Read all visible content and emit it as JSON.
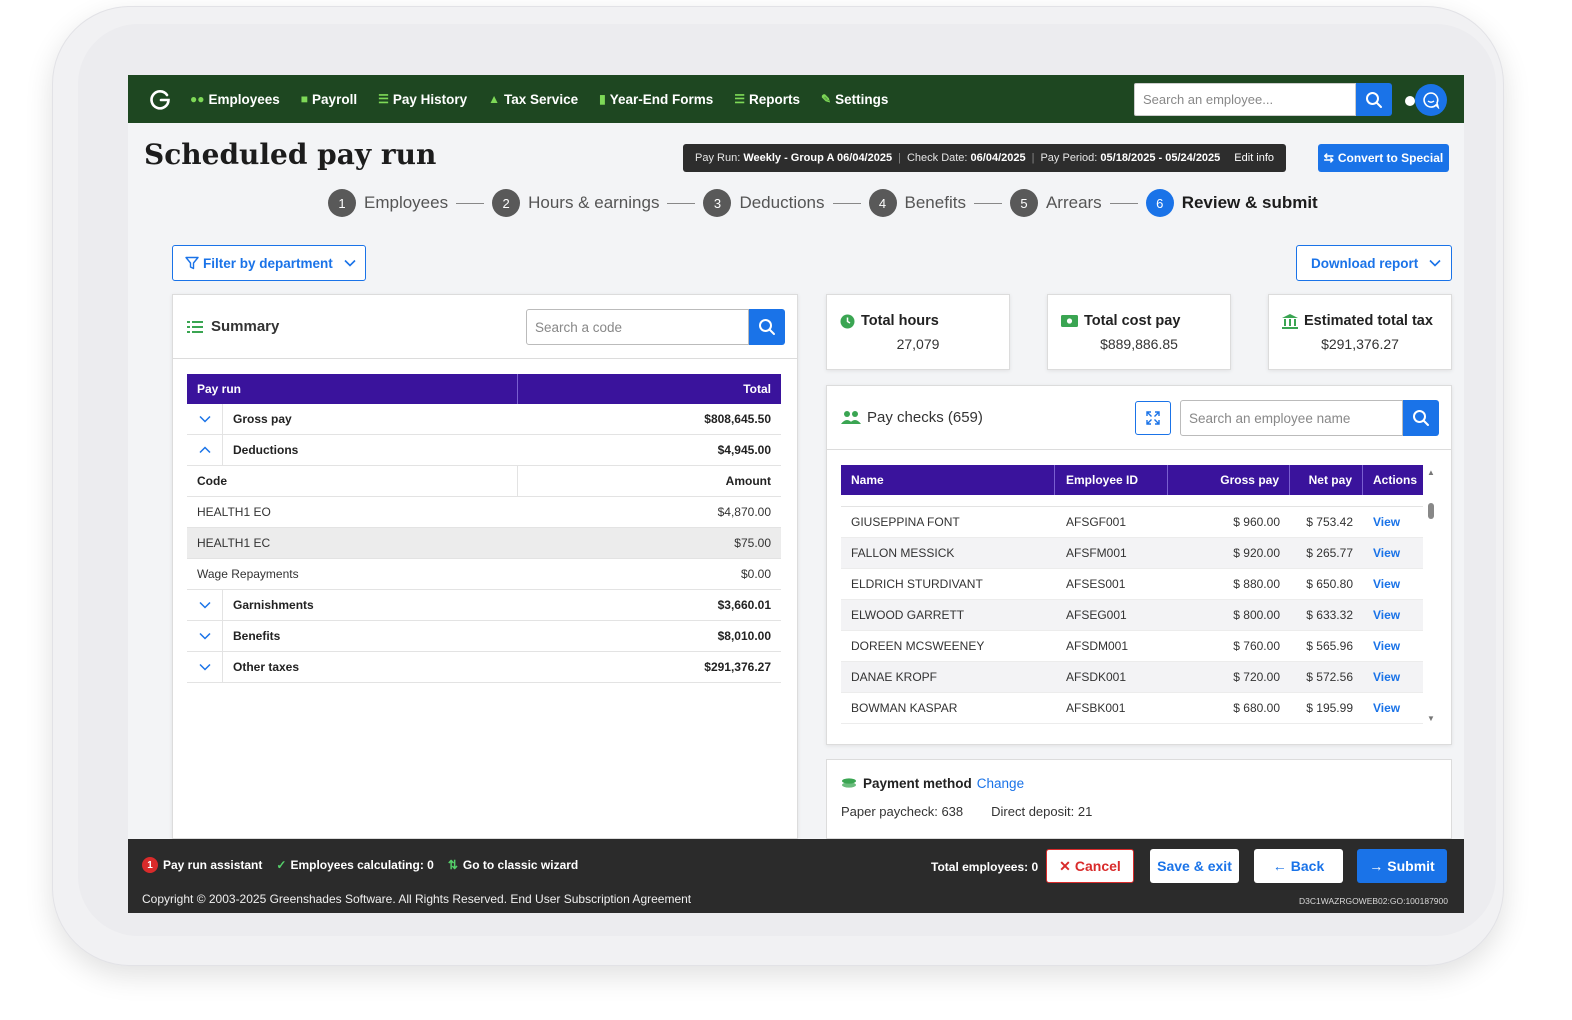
{
  "nav": {
    "items": [
      {
        "label": "Employees",
        "icon": "people-icon"
      },
      {
        "label": "Payroll",
        "icon": "money-icon"
      },
      {
        "label": "Pay History",
        "icon": "list-icon"
      },
      {
        "label": "Tax Service",
        "icon": "bank-icon"
      },
      {
        "label": "Year-End Forms",
        "icon": "document-icon"
      },
      {
        "label": "Reports",
        "icon": "list-icon"
      },
      {
        "label": "Settings",
        "icon": "wrench-icon"
      }
    ],
    "search_placeholder": "Search an employee..."
  },
  "header": {
    "title": "Scheduled pay run",
    "pay_run_label": "Pay Run:",
    "pay_run_value": "Weekly - Group A 06/04/2025",
    "check_date_label": "Check Date:",
    "check_date_value": "06/04/2025",
    "pay_period_label": "Pay Period:",
    "pay_period_value": "05/18/2025 - 05/24/2025",
    "edit_info": "Edit info",
    "convert_label": "Convert to Special"
  },
  "steps": [
    {
      "num": "1",
      "label": "Employees",
      "active": false
    },
    {
      "num": "2",
      "label": "Hours & earnings",
      "active": false
    },
    {
      "num": "3",
      "label": "Deductions",
      "active": false
    },
    {
      "num": "4",
      "label": "Benefits",
      "active": false
    },
    {
      "num": "5",
      "label": "Arrears",
      "active": false
    },
    {
      "num": "6",
      "label": "Review & submit",
      "active": true
    }
  ],
  "filter_label": "Filter by department",
  "download_label": "Download report",
  "summary": {
    "title": "Summary",
    "search_placeholder": "Search a code",
    "col_pay_run": "Pay run",
    "col_total": "Total",
    "gross_pay": {
      "label": "Gross pay",
      "value": "$808,645.50"
    },
    "deductions": {
      "label": "Deductions",
      "value": "$4,945.00"
    },
    "code_col": "Code",
    "amount_col": "Amount",
    "deduction_rows": [
      {
        "code": "HEALTH1 EO",
        "amount": "$4,870.00"
      },
      {
        "code": "HEALTH1 EC",
        "amount": "$75.00"
      },
      {
        "code": "Wage Repayments",
        "amount": "$0.00"
      }
    ],
    "garnishments": {
      "label": "Garnishments",
      "value": "$3,660.01"
    },
    "benefits": {
      "label": "Benefits",
      "value": "$8,010.00"
    },
    "other_taxes": {
      "label": "Other taxes",
      "value": "$291,376.27"
    }
  },
  "stats": {
    "total_hours": {
      "label": "Total hours",
      "value": "27,079"
    },
    "total_cost": {
      "label": "Total cost pay",
      "value": "$889,886.85"
    },
    "est_tax": {
      "label": "Estimated total tax",
      "value": "$291,376.27"
    }
  },
  "paychecks": {
    "title": "Pay checks (659)",
    "search_placeholder": "Search an employee name",
    "columns": {
      "name": "Name",
      "id": "Employee ID",
      "gross": "Gross pay",
      "net": "Net pay",
      "actions": "Actions"
    },
    "rows": [
      {
        "name": "GIUSEPPINA FONT",
        "id": "AFSGF001",
        "gross": "$ 960.00",
        "net": "$ 753.42",
        "action": "View"
      },
      {
        "name": "FALLON MESSICK",
        "id": "AFSFM001",
        "gross": "$ 920.00",
        "net": "$ 265.77",
        "action": "View"
      },
      {
        "name": "ELDRICH STURDIVANT",
        "id": "AFSES001",
        "gross": "$ 880.00",
        "net": "$ 650.80",
        "action": "View"
      },
      {
        "name": "ELWOOD GARRETT",
        "id": "AFSEG001",
        "gross": "$ 800.00",
        "net": "$ 633.32",
        "action": "View"
      },
      {
        "name": "DOREEN MCSWEENEY",
        "id": "AFSDM001",
        "gross": "$ 760.00",
        "net": "$ 565.96",
        "action": "View"
      },
      {
        "name": "DANAE KROPF",
        "id": "AFSDK001",
        "gross": "$ 720.00",
        "net": "$ 572.56",
        "action": "View"
      },
      {
        "name": "BOWMAN KASPAR",
        "id": "AFSBK001",
        "gross": "$ 680.00",
        "net": "$ 195.99",
        "action": "View"
      }
    ]
  },
  "payment": {
    "title": "Payment method",
    "change": "Change",
    "paper": "Paper paycheck: 638",
    "direct": "Direct deposit: 21"
  },
  "footer": {
    "assistant_badge": "1",
    "assistant": "Pay run assistant",
    "calculating": "Employees calculating: 0",
    "classic": "Go to classic wizard",
    "total_employees": "Total employees: 0",
    "cancel": "Cancel",
    "save_exit": "Save & exit",
    "back": "Back",
    "submit": "Submit",
    "copyright": "Copyright © 2003-2025 Greenshades Software. All Rights Reserved. End User Subscription Agreement",
    "build": "D3C1WAZRGOWEB02:GO:100187900"
  },
  "colors": {
    "nav_bg": "#1e4721",
    "accent": "#1a73e8",
    "table_header": "#3a139c",
    "footer_bg": "#2b2b2b"
  }
}
